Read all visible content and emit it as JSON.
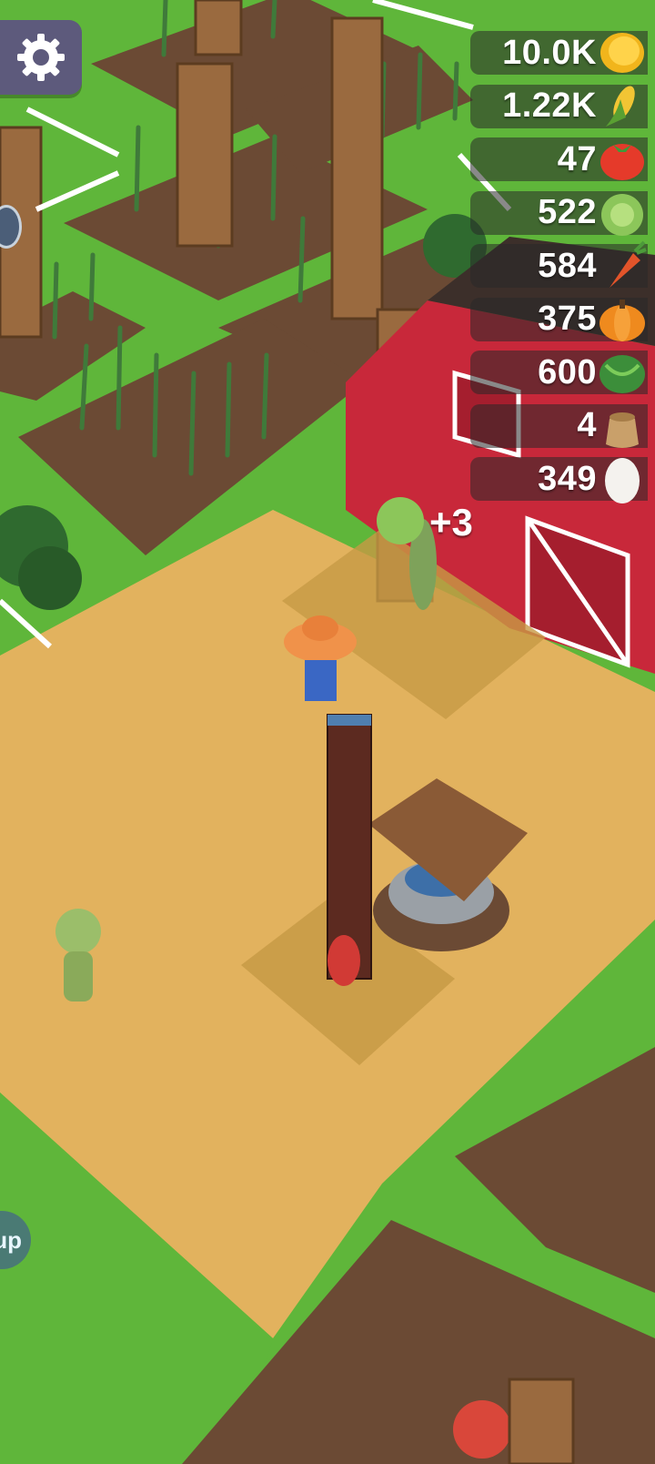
{
  "hud": {
    "settings_icon": "gear-icon",
    "resources": [
      {
        "id": "coins",
        "value": "10.0K",
        "icon": "gold-coin-icon"
      },
      {
        "id": "corn",
        "value": "1.22K",
        "icon": "corn-icon"
      },
      {
        "id": "tomato",
        "value": "47",
        "icon": "tomato-icon"
      },
      {
        "id": "cabbage",
        "value": "522",
        "icon": "cabbage-icon"
      },
      {
        "id": "carrot",
        "value": "584",
        "icon": "carrot-icon"
      },
      {
        "id": "pumpkin",
        "value": "375",
        "icon": "pumpkin-icon"
      },
      {
        "id": "watermelon",
        "value": "600",
        "icon": "watermelon-icon"
      },
      {
        "id": "flour",
        "value": "4",
        "icon": "flour-sack-icon"
      },
      {
        "id": "egg",
        "value": "349",
        "icon": "egg-icon"
      }
    ]
  },
  "floating": {
    "gain_text": "+3"
  },
  "edge_button": {
    "label": "up"
  },
  "colors": {
    "grass": "#5fb63a",
    "dirt_path": "#e2b25e",
    "soil": "#6b4a34",
    "barn_red": "#c8283a",
    "hud_panel": "#5d5a7c"
  }
}
